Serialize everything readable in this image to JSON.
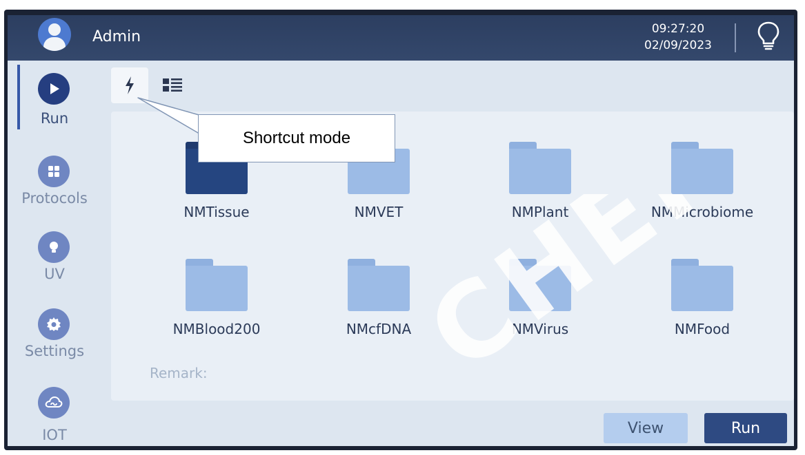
{
  "header": {
    "user_name": "Admin",
    "time": "09:27:20",
    "date": "02/09/2023",
    "bulb_icon": "lightbulb-icon",
    "avatar_icon": "user-avatar-icon"
  },
  "sidebar": {
    "items": [
      {
        "label": "Run",
        "icon": "play-icon",
        "active": true
      },
      {
        "label": "Protocols",
        "icon": "grid-icon",
        "active": false
      },
      {
        "label": "UV",
        "icon": "uv-lamp-icon",
        "active": false
      },
      {
        "label": "Settings",
        "icon": "gear-icon",
        "active": false
      },
      {
        "label": "IOT",
        "icon": "cloud-link-icon",
        "active": false
      }
    ]
  },
  "mode_toggle": {
    "shortcut_icon": "lightning-icon",
    "list_icon": "list-icon",
    "selected": "shortcut"
  },
  "folders": [
    {
      "name": "NMTissue",
      "selected": true
    },
    {
      "name": "NMVET",
      "selected": false
    },
    {
      "name": "NMPlant",
      "selected": false
    },
    {
      "name": "NMMicrobiome",
      "selected": false
    },
    {
      "name": "NMBlood200",
      "selected": false
    },
    {
      "name": "NMcfDNA",
      "selected": false
    },
    {
      "name": "NMVirus",
      "selected": false
    },
    {
      "name": "NMFood",
      "selected": false
    }
  ],
  "remark_label": "Remark:",
  "buttons": {
    "view": "View",
    "run": "Run"
  },
  "callout": {
    "text": "Shortcut mode"
  },
  "watermark": {
    "text": "CHER SA"
  },
  "colors": {
    "header_bg": "#2c3e60",
    "accent_dark": "#253e80",
    "folder_light": "#9cbbe6",
    "folder_selected": "#254580",
    "run_button": "#2e4a82",
    "view_button": "#b4cdee"
  }
}
